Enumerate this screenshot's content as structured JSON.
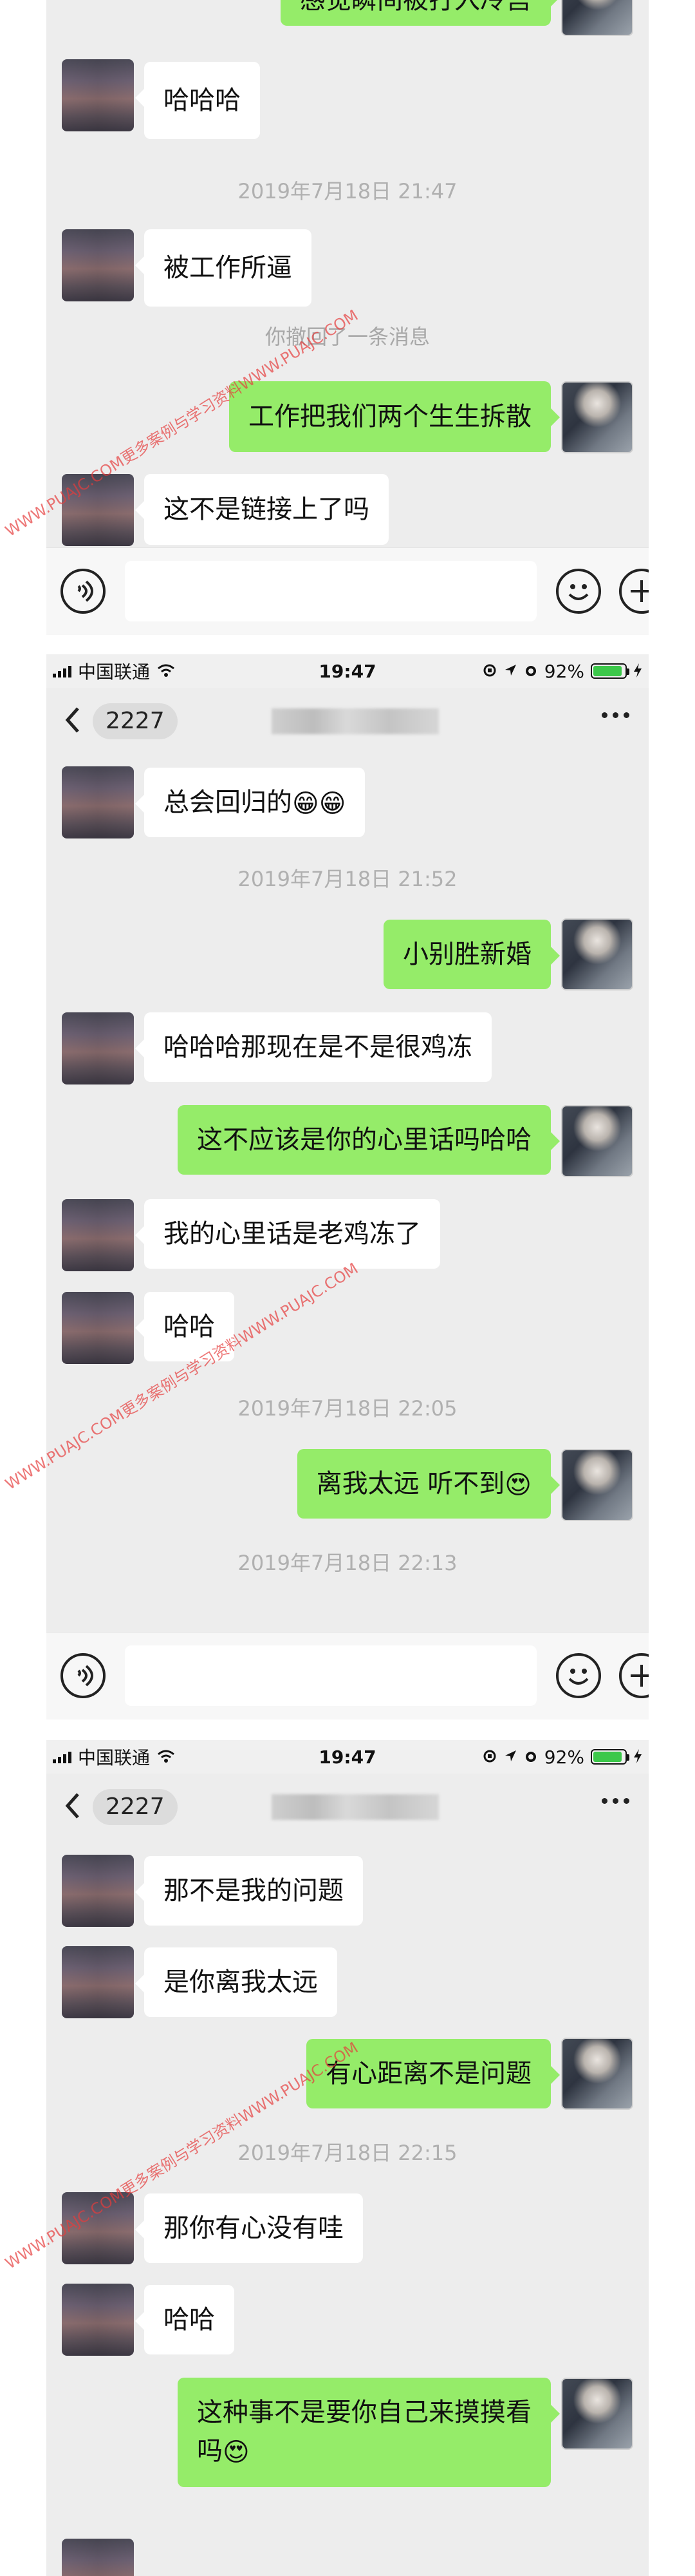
{
  "colors": {
    "chat_background": "#ededed",
    "incoming_bubble": "#ffffff",
    "outgoing_bubble": "#95ec69",
    "timestamp_text": "#b0b0b0",
    "watermark": "#e63c3c"
  },
  "watermark_text": "WWW.PUAJC.COM更多案例与学习资料WWW.PUAJC.COM",
  "status_bar": {
    "carrier": "中国联通",
    "time": "19:47",
    "battery_percent": "92%",
    "battery_level": 0.92
  },
  "nav": {
    "badge": "2227",
    "back_icon": "chevron-left-icon",
    "more_icon": "ellipsis-icon"
  },
  "screen1": {
    "partial_out": "感觉瞬间被打入冷宫",
    "msg1": "哈哈哈",
    "ts1": "2019年7月18日 21:47",
    "msg2": "被工作所逼",
    "recall_notice": "你撤回了一条消息",
    "msg3": "工作把我们两个生生拆散",
    "msg4": "这不是链接上了吗"
  },
  "screen2": {
    "msg1": "总会回归的",
    "msg1_emoji": "😁😁",
    "ts1": "2019年7月18日 21:52",
    "msg2": "小别胜新婚",
    "msg3": "哈哈哈那现在是不是很鸡冻",
    "msg4": "这不应该是你的心里话吗哈哈",
    "msg5": "我的心里话是老鸡冻了",
    "msg6": "哈哈",
    "ts2": "2019年7月18日 22:05",
    "msg7": "离我太远 听不到",
    "msg7_emoji": "😍",
    "ts3": "2019年7月18日 22:13"
  },
  "screen3": {
    "msg1": "那不是我的问题",
    "msg2": "是你离我太远",
    "msg3": "有心距离不是问题",
    "ts1": "2019年7月18日 22:15",
    "msg4": "那你有心没有哇",
    "msg5": "哈哈",
    "msg6_line1": "这种事不是要你自己来摸摸看",
    "msg6_line2": "吗",
    "msg6_emoji": "😍"
  }
}
